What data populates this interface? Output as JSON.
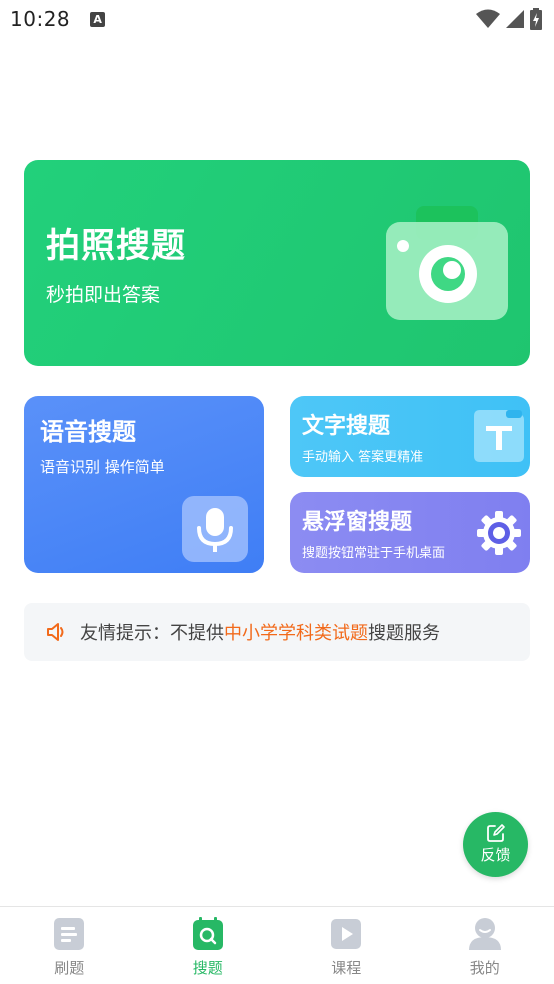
{
  "status_bar": {
    "time": "10:28",
    "notification_icon": "A"
  },
  "cards": {
    "photo": {
      "title": "拍照搜题",
      "subtitle": "秒拍即出答案",
      "icon": "camera-icon"
    },
    "voice": {
      "title": "语音搜题",
      "subtitle": "语音识别 操作简单",
      "icon": "microphone-icon"
    },
    "text": {
      "title": "文字搜题",
      "subtitle": "手动输入 答案更精准",
      "icon": "text-t-icon"
    },
    "float": {
      "title": "悬浮窗搜题",
      "subtitle": "搜题按钮常驻于手机桌面",
      "icon": "gear-icon"
    }
  },
  "notice": {
    "prefix": "友情提示：不提供",
    "highlight": "中小学学科类试题",
    "suffix": "搜题服务",
    "highlight_color": "#f26a1b"
  },
  "feedback": {
    "label": "反馈"
  },
  "bottom_nav": {
    "items": [
      {
        "label": "刷题",
        "icon": "document-icon",
        "active": false
      },
      {
        "label": "搜题",
        "icon": "search-calendar-icon",
        "active": true
      },
      {
        "label": "课程",
        "icon": "play-icon",
        "active": false
      },
      {
        "label": "我的",
        "icon": "user-icon",
        "active": false
      }
    ]
  },
  "colors": {
    "accent": "#27b865",
    "photo_card": "#22d07b",
    "voice_card": "#4f88f7",
    "text_card": "#47c4f7",
    "float_card": "#8686f1"
  }
}
